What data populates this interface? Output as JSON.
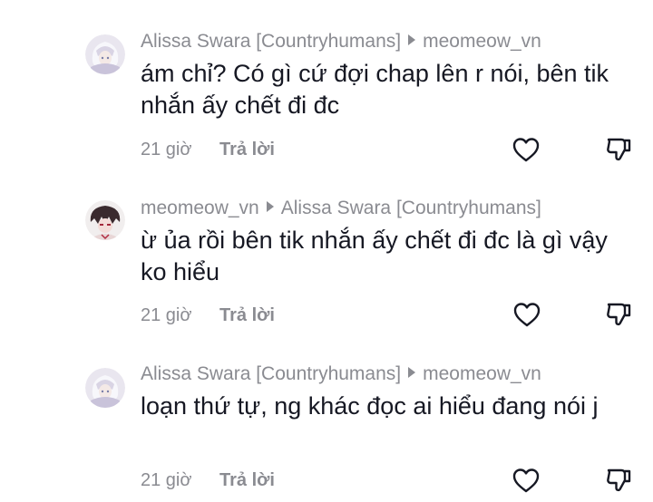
{
  "comments": [
    {
      "author": "Alissa Swara [Countryhumans]",
      "reply_to": "meomeow_vn",
      "text": "ám chỉ? Có gì cứ đợi chap lên r nói, bên tik nhắn ấy chết đi đc",
      "time": "21 giờ",
      "reply_label": "Trả lời",
      "avatar": "white-hair-character-avatar"
    },
    {
      "author": "meomeow_vn",
      "reply_to": "Alissa Swara [Countryhumans]",
      "text": "ừ ủa rồi bên tik nhắn ấy chết đi đc là gì vậy ko hiểu",
      "time": "21 giờ",
      "reply_label": "Trả lời",
      "avatar": "dark-hair-character-avatar"
    },
    {
      "author": "Alissa Swara [Countryhumans]",
      "reply_to": "meomeow_vn",
      "text": "loạn thứ tự, ng khác đọc ai hiểu đang nói j",
      "time": "21 giờ",
      "reply_label": "Trả lời",
      "avatar": "white-hair-character-avatar"
    }
  ],
  "icons": {
    "like": "heart-outline-icon",
    "dislike": "thumbs-down-outline-icon"
  },
  "colors": {
    "text": "#161823",
    "muted": "#8a8b91"
  }
}
